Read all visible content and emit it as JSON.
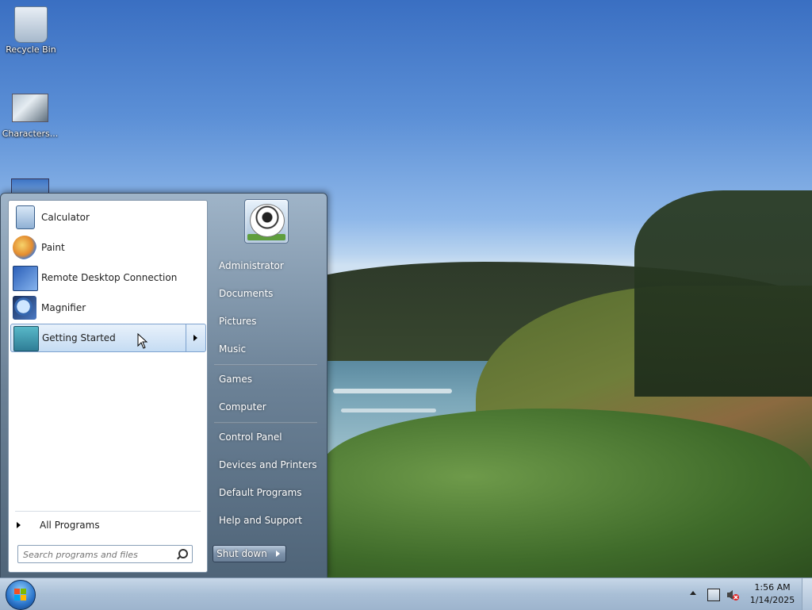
{
  "desktop": {
    "icons": [
      {
        "label": "Recycle Bin",
        "icon": "recycle-bin-icon"
      },
      {
        "label": "Characters...",
        "icon": "characters-icon"
      }
    ]
  },
  "start_menu": {
    "programs": [
      {
        "label": "Calculator",
        "icon": "calculator-icon"
      },
      {
        "label": "Paint",
        "icon": "paint-icon"
      },
      {
        "label": "Remote Desktop Connection",
        "icon": "remote-desktop-icon"
      },
      {
        "label": "Magnifier",
        "icon": "magnifier-icon"
      },
      {
        "label": "Getting Started",
        "icon": "getting-started-icon",
        "selected": true,
        "has_submenu": true
      }
    ],
    "all_programs": "All Programs",
    "search_placeholder": "Search programs and files",
    "user_picture": "soccer-ball-avatar",
    "right_links": [
      "Administrator",
      "Documents",
      "Pictures",
      "Music",
      "Games",
      "Computer",
      "Control Panel",
      "Devices and Printers",
      "Default Programs",
      "Help and Support"
    ],
    "shutdown_label": "Shut down"
  },
  "taskbar": {
    "start_button": "windows-start-orb",
    "tray_icons": [
      "show-hidden-icons",
      "network-icon",
      "volume-muted-icon"
    ],
    "time": "1:56 AM",
    "date": "1/14/2025"
  },
  "colors": {
    "selection": "#c5dcf3",
    "start_menu_right": "#6b8196",
    "taskbar": "#a9bfd6"
  }
}
